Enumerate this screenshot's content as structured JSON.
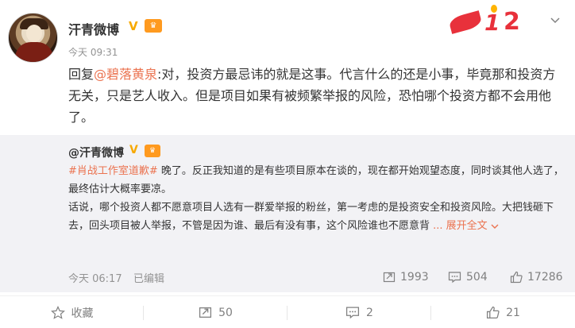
{
  "author": {
    "name": "汗青微博",
    "time": "今天 09:31"
  },
  "post": {
    "reply_prefix": "回复",
    "mention": "@碧落黄泉",
    "text": ":对，投资方最忌讳的就是这事。代言什么的还是小事，毕竟那和投资方无关，只是艺人收入。但是项目如果有被频繁举报的风险，恐怕哪个投资方都不会用他了。"
  },
  "retweet": {
    "author": "@汗青微博",
    "topic": "#肖战工作室道歉#",
    "text_1": " 晚了。反正我知道的是有些项目原本在谈的，现在都开始观望态度，同时谈其他人选了，最终估计大概率要凉。",
    "text_2": "话说，哪个投资人都不愿意项目人选有一群爱举报的粉丝，第一考虑的是投资安全和投资风险。大把钱砸下去，回头项目被人举报，不管是因为谁、最后有没有事，这个风险谁也不愿意背",
    "expand": " ... 展开全文 ",
    "time": "今天 06:17",
    "edited": "已编辑",
    "reposts": "1993",
    "comments": "504",
    "likes": "17286"
  },
  "actions": {
    "favorite": "收藏",
    "repost": "50",
    "comment": "2",
    "like": "21"
  },
  "icons": {
    "verified": "V",
    "vip": "vip-badge",
    "badge_text_1": "1",
    "badge_text_2": "2"
  },
  "colors": {
    "accent": "#eb7350",
    "verified": "#f7a900",
    "retweet_bg": "#f2f2f5",
    "muted": "#939393"
  }
}
